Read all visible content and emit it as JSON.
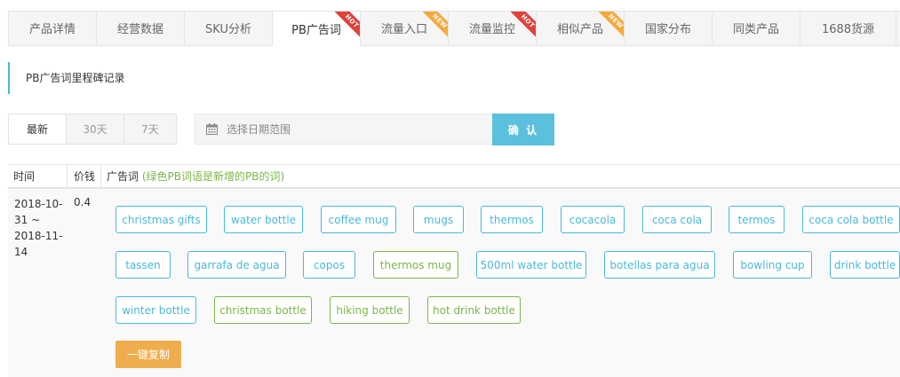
{
  "tabs": [
    {
      "label": "产品详情",
      "badge": ""
    },
    {
      "label": "经营数据",
      "badge": ""
    },
    {
      "label": "SKU分析",
      "badge": ""
    },
    {
      "label": "PB广告词",
      "badge": "HOT",
      "active": true
    },
    {
      "label": "流量入口",
      "badge": "NEW"
    },
    {
      "label": "流量监控",
      "badge": "HOT"
    },
    {
      "label": "相似产品",
      "badge": "NEW"
    },
    {
      "label": "国家分布",
      "badge": ""
    },
    {
      "label": "同类产品",
      "badge": ""
    },
    {
      "label": "1688货源",
      "badge": ""
    }
  ],
  "section": {
    "title": "PB广告词里程碑记录"
  },
  "filters": {
    "latest": "最新",
    "d30": "30天",
    "d7": "7天",
    "date_placeholder": "选择日期范围",
    "confirm": "确 认"
  },
  "table": {
    "headers": {
      "time": "时间",
      "price": "价钱",
      "keywords": "广告词",
      "note": "(绿色PB词语是新增的PB的词)"
    },
    "row": {
      "time": "2018-10-31 ~ 2018-11-14",
      "price": "0.4",
      "keywords": [
        {
          "text": "christmas gifts",
          "new": false
        },
        {
          "text": "water bottle",
          "new": false
        },
        {
          "text": "coffee mug",
          "new": false
        },
        {
          "text": "mugs",
          "new": false
        },
        {
          "text": "thermos",
          "new": false
        },
        {
          "text": "cocacola",
          "new": false
        },
        {
          "text": "coca cola",
          "new": false
        },
        {
          "text": "termos",
          "new": false
        },
        {
          "text": "coca cola bottle",
          "new": false
        },
        {
          "text": "tassen",
          "new": false
        },
        {
          "text": "garrafa de agua",
          "new": false
        },
        {
          "text": "copos",
          "new": false
        },
        {
          "text": "thermos mug",
          "new": true
        },
        {
          "text": "500ml water bottle",
          "new": false
        },
        {
          "text": "botellas para agua",
          "new": false
        },
        {
          "text": "bowling cup",
          "new": false
        },
        {
          "text": "drink bottle",
          "new": false
        },
        {
          "text": "winter bottle",
          "new": false
        },
        {
          "text": "christmas bottle",
          "new": true
        },
        {
          "text": "hiking bottle",
          "new": true
        },
        {
          "text": "hot drink bottle",
          "new": true
        }
      ],
      "copy_label": "一键复制"
    }
  },
  "colors": {
    "accent": "#4ab8d8",
    "new_keyword": "#7ab648",
    "hot": "#e0413c",
    "new_badge": "#f5a93d",
    "copy": "#f0ad4e"
  }
}
